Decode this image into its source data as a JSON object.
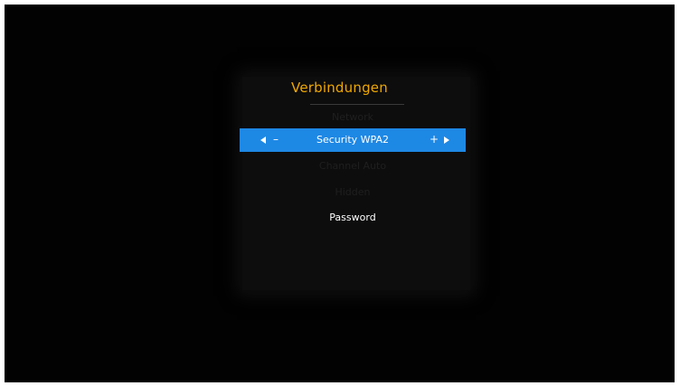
{
  "menu": {
    "title": "Verbindungen",
    "rows": {
      "above_selected": "Network",
      "selected_label": "Security WPA2",
      "below_1": "Channel Auto",
      "below_2": "Hidden",
      "password_label": "Password"
    },
    "controls": {
      "decrease": "–",
      "increase": "+"
    }
  },
  "colors": {
    "background": "#020202",
    "title": "#f0a800",
    "highlight": "#1e88e5",
    "text": "#ffffff"
  }
}
